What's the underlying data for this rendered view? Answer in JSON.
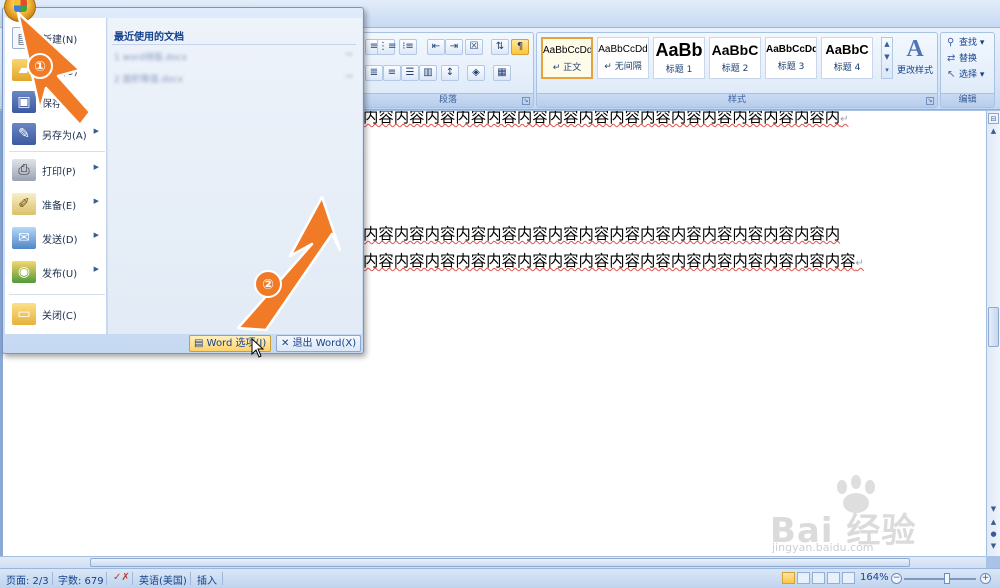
{
  "menu": {
    "items": [
      {
        "label": "新建(N)",
        "icon": "new-document-icon",
        "has_arrow": false
      },
      {
        "label": "打开(O)",
        "icon": "open-folder-icon",
        "has_arrow": false
      },
      {
        "label": "保存(S)",
        "icon": "save-icon",
        "has_arrow": false
      },
      {
        "label": "另存为(A)",
        "icon": "save-as-icon",
        "has_arrow": true
      },
      {
        "label": "打印(P)",
        "icon": "printer-icon",
        "has_arrow": true
      },
      {
        "label": "准备(E)",
        "icon": "prepare-icon",
        "has_arrow": true
      },
      {
        "label": "发送(D)",
        "icon": "send-icon",
        "has_arrow": true
      },
      {
        "label": "发布(U)",
        "icon": "publish-icon",
        "has_arrow": true
      },
      {
        "label": "关闭(C)",
        "icon": "close-folder-icon",
        "has_arrow": false
      }
    ],
    "recent_title": "最近使用的文档",
    "recent_docs": [
      "1 word排版.docx",
      "2 面积等值.docx"
    ],
    "options_button": "Word 选项(I)",
    "exit_button": "退出 Word(X)"
  },
  "ribbon": {
    "paragraph_label": "段落",
    "styles_label": "样式",
    "editing_label": "编辑",
    "styles": [
      {
        "sample": "AaBbCcDd",
        "name": "↵ 正文",
        "active": true
      },
      {
        "sample": "AaBbCcDd",
        "name": "↵ 无间隔",
        "active": false
      },
      {
        "sample": "AaBb",
        "name": "标题 1",
        "active": false
      },
      {
        "sample": "AaBbC",
        "name": "标题 2",
        "active": false
      },
      {
        "sample": "AaBbCcDd",
        "name": "标题 3",
        "active": false
      },
      {
        "sample": "AaBbC",
        "name": "标题 4",
        "active": false
      }
    ],
    "change_styles": "更改样式",
    "find": "查找",
    "replace": "替换",
    "select": "选择"
  },
  "document": {
    "line1": "内容内容内容内容内容内容内容内容内容内容内容内容内容内容内容内",
    "line2": "内容内容内容内容内容内容内容内容内容内容内容内容内容内容内容内",
    "line3": "内容内容内容内容内容内容内容内容内容内容内容内容内容内容内容内容"
  },
  "status": {
    "page": "页面: 2/3",
    "words": "字数: 679",
    "language": "英语(美国)",
    "mode": "插入",
    "zoom": "164%"
  },
  "annotations": {
    "step1": "①",
    "step2": "②"
  },
  "watermark": {
    "brand": "Bai 经验",
    "url": "jingyan.baidu.com"
  }
}
